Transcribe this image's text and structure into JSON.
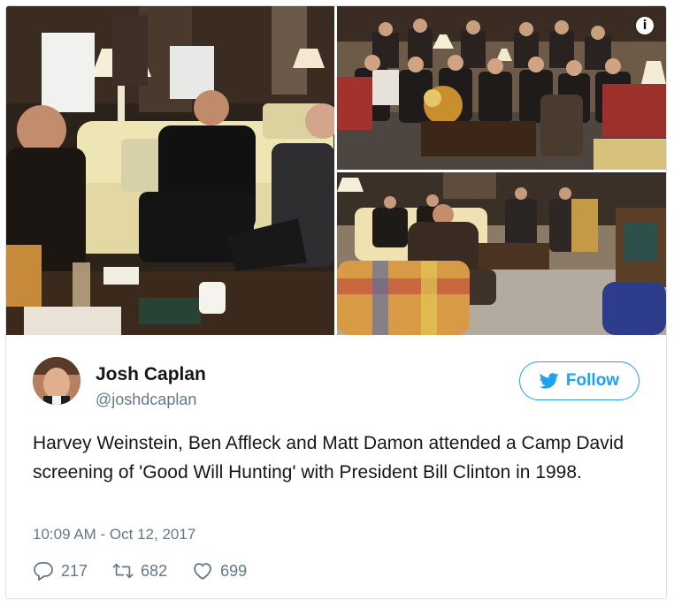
{
  "tweet": {
    "author_name": "Josh Caplan",
    "author_handle": "@joshdcaplan",
    "follow_label": "Follow",
    "text": "Harvey Weinstein, Ben Affleck and Matt Damon attended a Camp David screening of 'Good Will Hunting' with President Bill Clinton in 1998.",
    "timestamp": "10:09 AM - Oct 12, 2017",
    "replies": "217",
    "retweets": "682",
    "likes": "699"
  },
  "media": {
    "info_icon": "i",
    "photo_count": 3
  },
  "colors": {
    "accent": "#1da1f2",
    "secondary_text": "#657786",
    "border": "#d9dfe4"
  },
  "icons": {
    "info": "info-icon",
    "follow": "twitter-bird-icon",
    "reply": "reply-icon",
    "retweet": "retweet-icon",
    "like": "heart-icon"
  }
}
